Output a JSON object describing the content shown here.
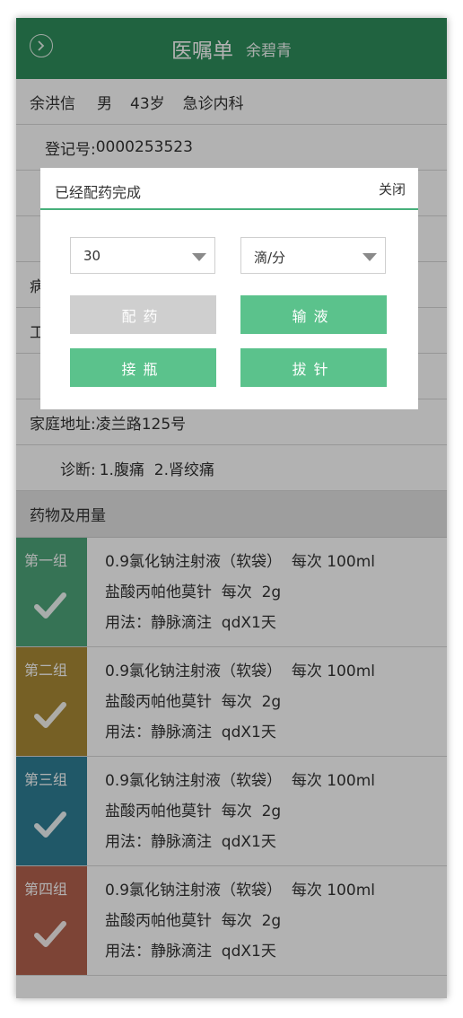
{
  "header": {
    "title": "医嘱单",
    "subtitle": "余碧青"
  },
  "patient": {
    "name": "余洪信",
    "gender": "男",
    "age": "43岁",
    "dept": "急诊内科",
    "reg_label": "登记号:",
    "reg_no": "0000253523",
    "row3_text": "",
    "row4_text": "",
    "row5_partial": "病",
    "row6_partial": "工",
    "addr_label": "家庭地址:",
    "addr": "凌兰路125号",
    "diag_label": "诊断:",
    "diag": "1.腹痛  2.肾绞痛"
  },
  "drugs_section": "药物及用量",
  "groups": [
    {
      "tag": "第一组",
      "color": "#4ea57a",
      "line1": "0.9氯化钠注射液（软袋）  每次 100ml",
      "line2": "盐酸丙帕他莫针  每次  2g",
      "line3": "用法：静脉滴注  qdX1天"
    },
    {
      "tag": "第二组",
      "color": "#a98a36",
      "line1": "0.9氯化钠注射液（软袋）  每次 100ml",
      "line2": "盐酸丙帕他莫针  每次  2g",
      "line3": "用法：静脉滴注  qdX1天"
    },
    {
      "tag": "第三组",
      "color": "#2f7f95",
      "line1": "0.9氯化钠注射液（软袋）  每次 100ml",
      "line2": "盐酸丙帕他莫针  每次  2g",
      "line3": "用法：静脉滴注  qdX1天"
    },
    {
      "tag": "第四组",
      "color": "#b4624e",
      "line1": "0.9氯化钠注射液（软袋）  每次 100ml",
      "line2": "盐酸丙帕他莫针  每次  2g",
      "line3": "用法：静脉滴注  qdX1天"
    }
  ],
  "dialog": {
    "title": "已经配药完成",
    "close": "关闭",
    "rate_value": "30",
    "unit_value": "滴/分",
    "btn_dispense": "配药",
    "btn_infuse": "输液",
    "btn_connect": "接瓶",
    "btn_remove": "拔针"
  },
  "colors": {
    "header": "#2f8f5c",
    "accent": "#5bc28c",
    "disabled": "#cfcfcf"
  },
  "icons": {
    "back": "chevron-right-circle-icon",
    "check": "checkmark-icon",
    "caret": "caret-down-icon"
  }
}
